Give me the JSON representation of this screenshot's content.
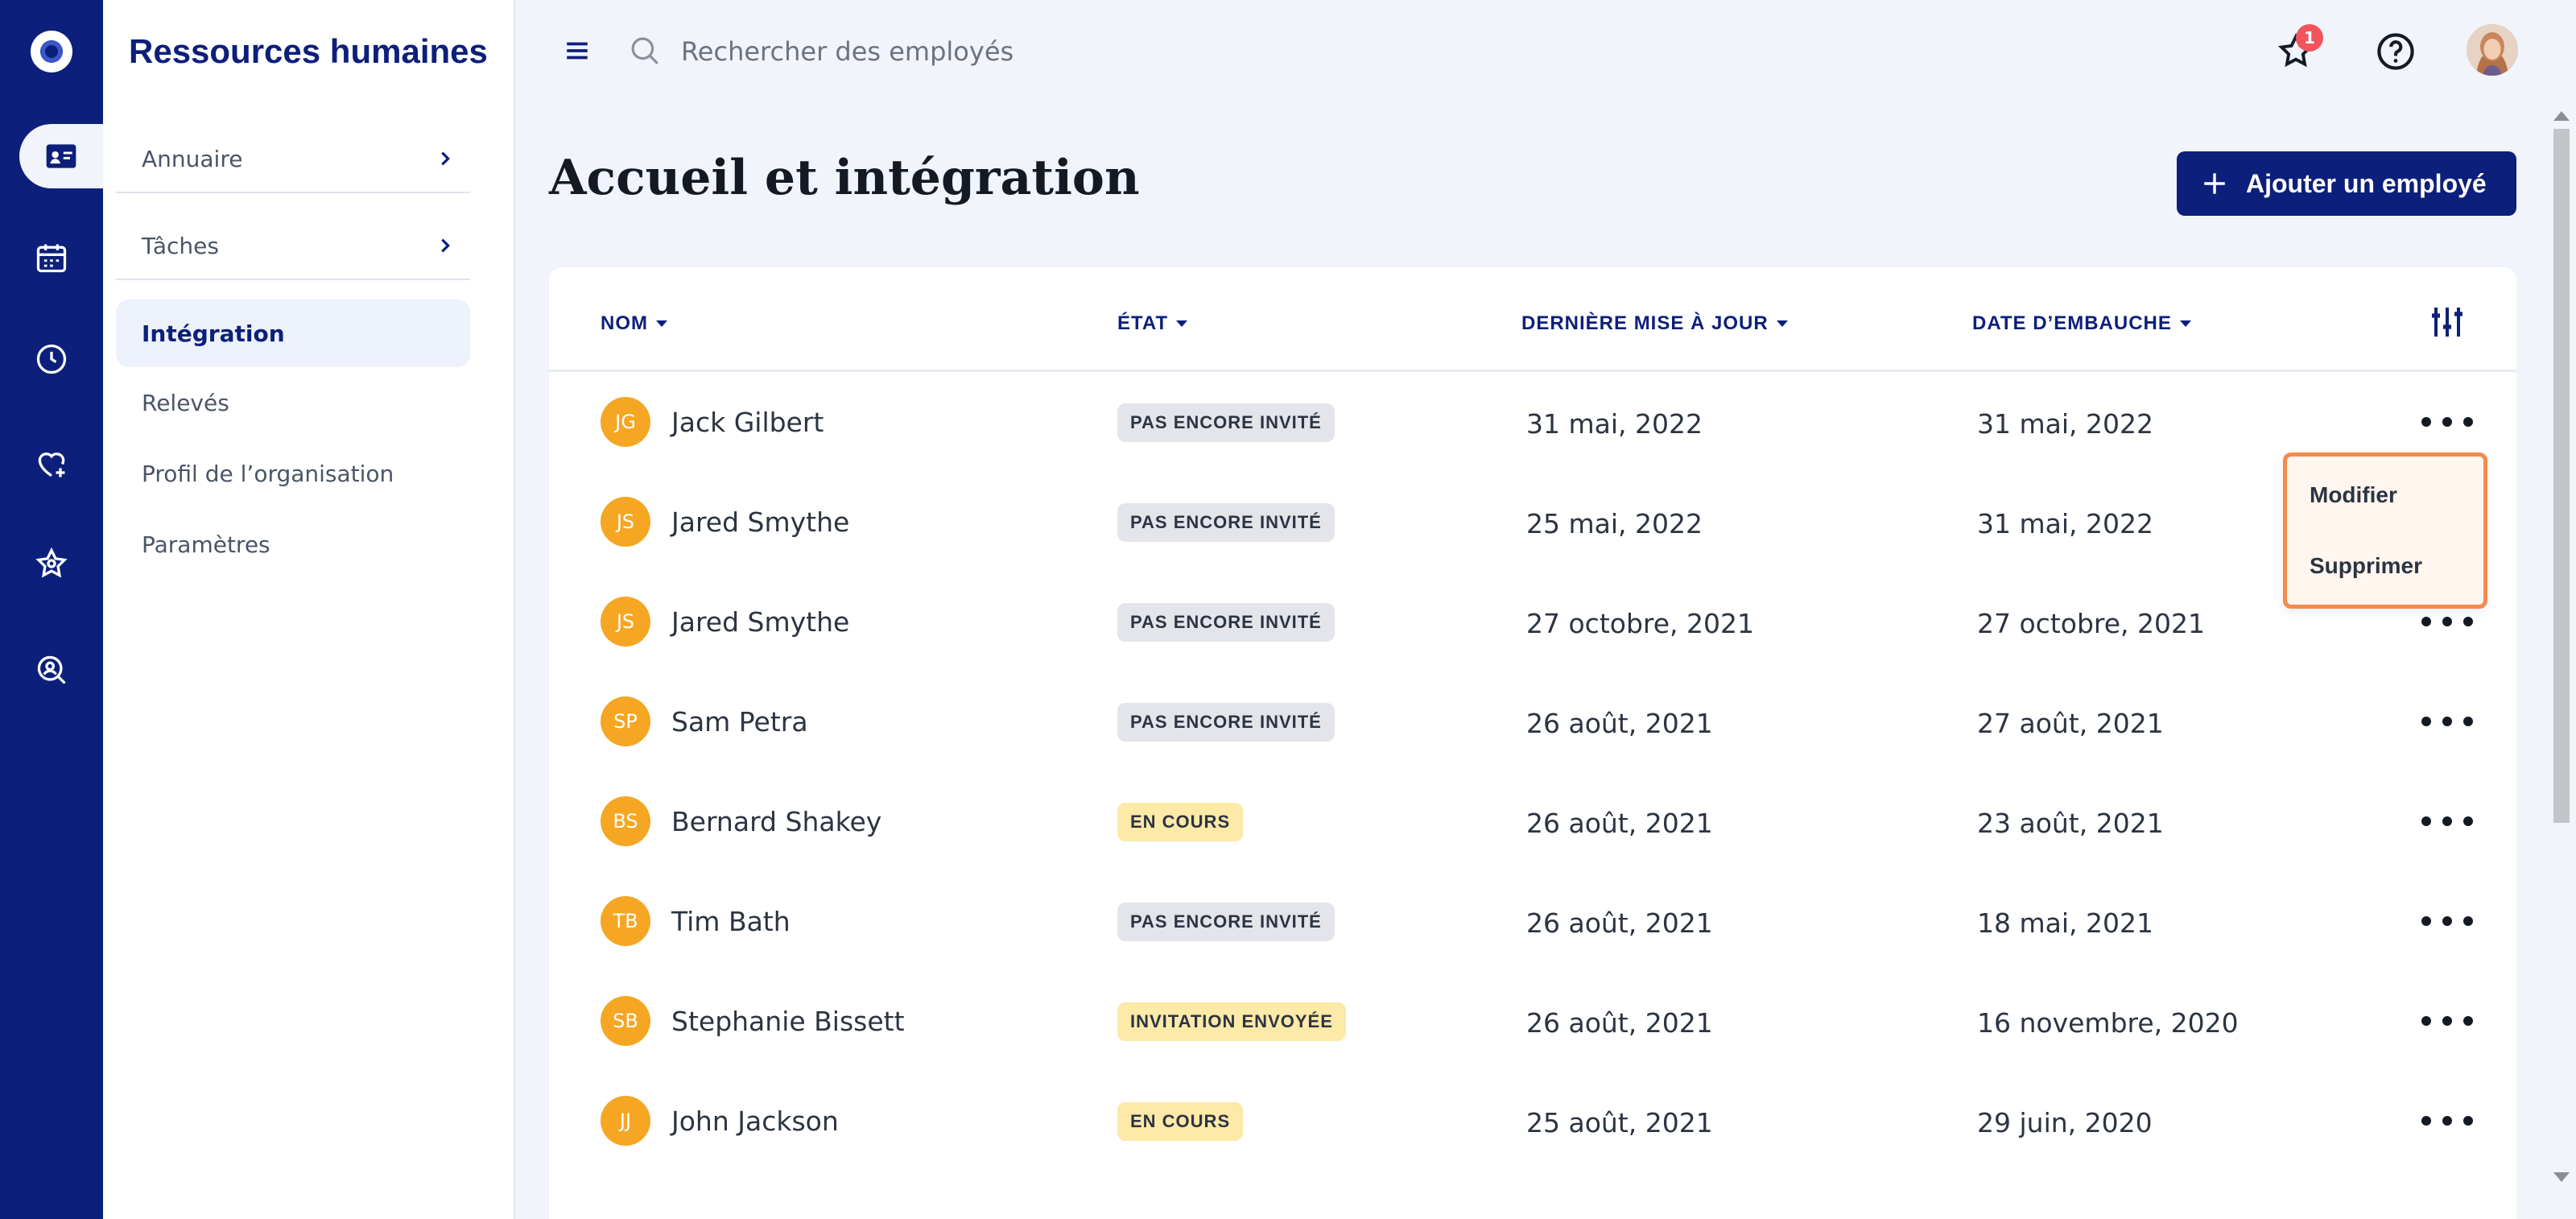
{
  "app": {
    "section_title": "Ressources humaines"
  },
  "rail": {
    "icons": [
      "logo-icon",
      "contact-card-icon",
      "calendar-icon",
      "clock-icon",
      "heart-plus-icon",
      "star-icon",
      "search-person-icon"
    ],
    "active": "contact-card-icon"
  },
  "subnav": {
    "items": [
      {
        "label": "Annuaire",
        "has_chevron": true
      },
      {
        "label": "Tâches",
        "has_chevron": true
      },
      {
        "label": "Intégration",
        "active": true
      },
      {
        "label": "Relevés"
      },
      {
        "label": "Profil de l’organisation"
      },
      {
        "label": "Paramètres"
      }
    ]
  },
  "topbar": {
    "search_placeholder": "Rechercher des employés",
    "notification_count": "1"
  },
  "page": {
    "title": "Accueil et intégration",
    "add_button": "Ajouter un employé"
  },
  "table": {
    "headers": {
      "name": "NOM",
      "status": "ÉTAT",
      "updated": "DERNIÈRE MISE À JOUR",
      "hired": "DATE D’EMBAUCHE"
    },
    "rows": [
      {
        "initials": "JG",
        "name": "Jack Gilbert",
        "status": "PAS ENCORE INVITÉ",
        "status_kind": "grey",
        "updated": "31 mai, 2022",
        "hired": "31 mai, 2022"
      },
      {
        "initials": "JS",
        "name": "Jared Smythe",
        "status": "PAS ENCORE INVITÉ",
        "status_kind": "grey",
        "updated": "25 mai, 2022",
        "hired": "31 mai, 2022"
      },
      {
        "initials": "JS",
        "name": "Jared Smythe",
        "status": "PAS ENCORE INVITÉ",
        "status_kind": "grey",
        "updated": "27 octobre, 2021",
        "hired": "27 octobre, 2021"
      },
      {
        "initials": "SP",
        "name": "Sam Petra",
        "status": "PAS ENCORE INVITÉ",
        "status_kind": "grey",
        "updated": "26 août, 2021",
        "hired": "27 août, 2021"
      },
      {
        "initials": "BS",
        "name": "Bernard Shakey",
        "status": "EN COURS",
        "status_kind": "yellow",
        "updated": "26 août, 2021",
        "hired": "23 août, 2021"
      },
      {
        "initials": "TB",
        "name": "Tim Bath",
        "status": "PAS ENCORE INVITÉ",
        "status_kind": "grey",
        "updated": "26 août, 2021",
        "hired": "18 mai, 2021"
      },
      {
        "initials": "SB",
        "name": "Stephanie Bissett",
        "status": "INVITATION ENVOYÉE",
        "status_kind": "yellow",
        "updated": "26 août, 2021",
        "hired": "16 novembre, 2020"
      },
      {
        "initials": "JJ",
        "name": "John Jackson",
        "status": "EN COURS",
        "status_kind": "yellow",
        "updated": "25 août, 2021",
        "hired": "29 juin, 2020"
      }
    ]
  },
  "row_menu": {
    "items": [
      "Modifier",
      "Supprimer"
    ]
  },
  "colors": {
    "brand": "#0c1f7a",
    "avatar": "#f5a623",
    "menu_border": "#f58a4b",
    "badge_grey": "#e3e5ea",
    "badge_yellow": "#fde9a8"
  }
}
